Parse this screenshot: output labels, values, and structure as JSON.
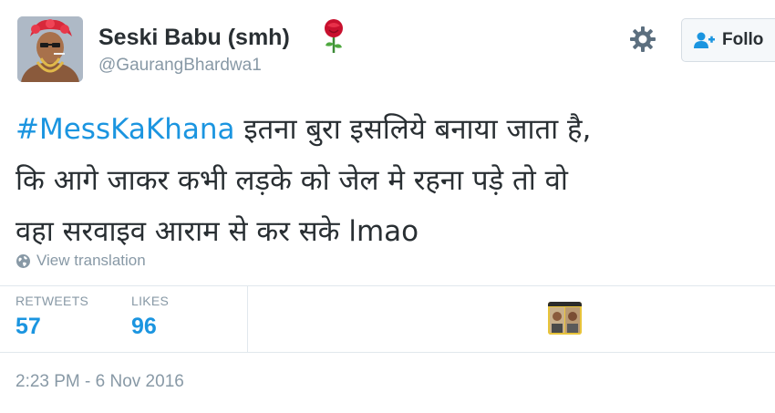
{
  "author": {
    "display_name": "Seski Babu (smh)",
    "handle": "@GaurangBhardwa1"
  },
  "actions": {
    "follow_label": "Follo"
  },
  "tweet": {
    "hashtag": "#MessKaKhana",
    "line1_rest": " इतना बुरा इसलिये बनाया जाता है,",
    "line2": "कि आगे जाकर कभी लड़के को जेल मे रहना पड़े तो वो",
    "line3": "वहा सरवाइव आराम से कर सके lmao"
  },
  "translate_label": "View translation",
  "stats": {
    "retweets_label": "RETWEETS",
    "retweets_count": "57",
    "likes_label": "LIKES",
    "likes_count": "96"
  },
  "timestamp": "2:23 PM - 6 Nov 2016",
  "colors": {
    "link": "#1b95e0",
    "muted": "#8899a6",
    "text": "#292f33"
  },
  "icons": [
    "rose-emoji-icon",
    "gear-icon",
    "add-user-icon",
    "globe-icon"
  ]
}
